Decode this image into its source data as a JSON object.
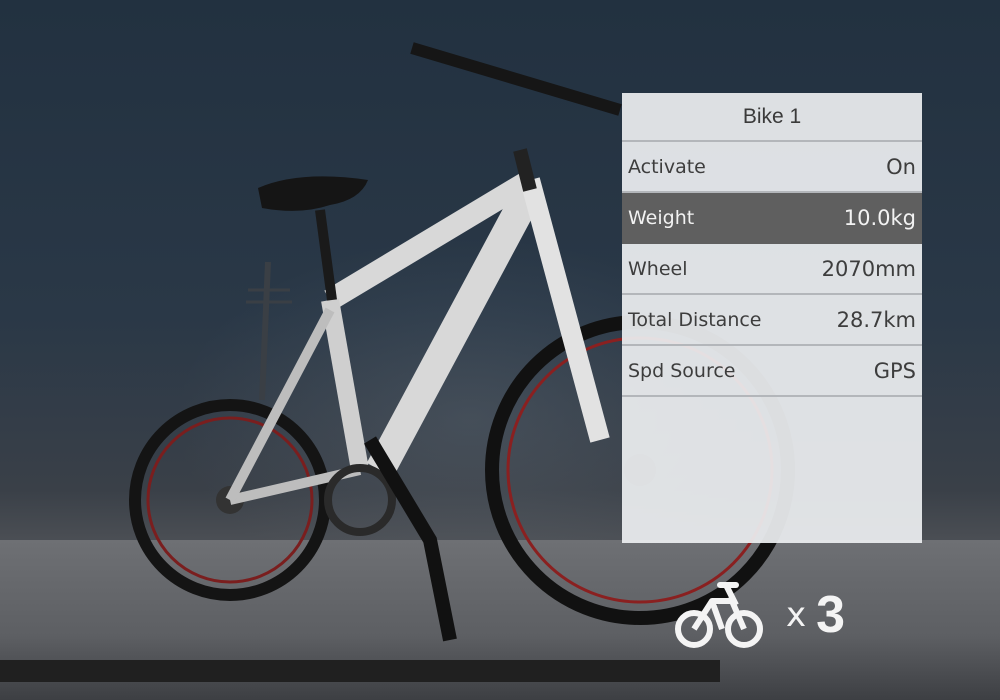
{
  "panel": {
    "title": "Bike 1",
    "rows": [
      {
        "label": "Activate",
        "value": "On",
        "selected": false
      },
      {
        "label": "Weight",
        "value": "10.0kg",
        "selected": true
      },
      {
        "label": "Wheel",
        "value": "2070mm",
        "selected": false
      },
      {
        "label": "Total Distance",
        "value": "28.7km",
        "selected": false
      },
      {
        "label": "Spd Source",
        "value": "GPS",
        "selected": false
      }
    ]
  },
  "bike_count": {
    "icon": "bicycle-icon",
    "multiplier": "x",
    "count": "3"
  },
  "colors": {
    "panel_bg": "#eceef0",
    "selected_row_bg": "#5f5f5f",
    "divider": "#b3b6ba"
  }
}
